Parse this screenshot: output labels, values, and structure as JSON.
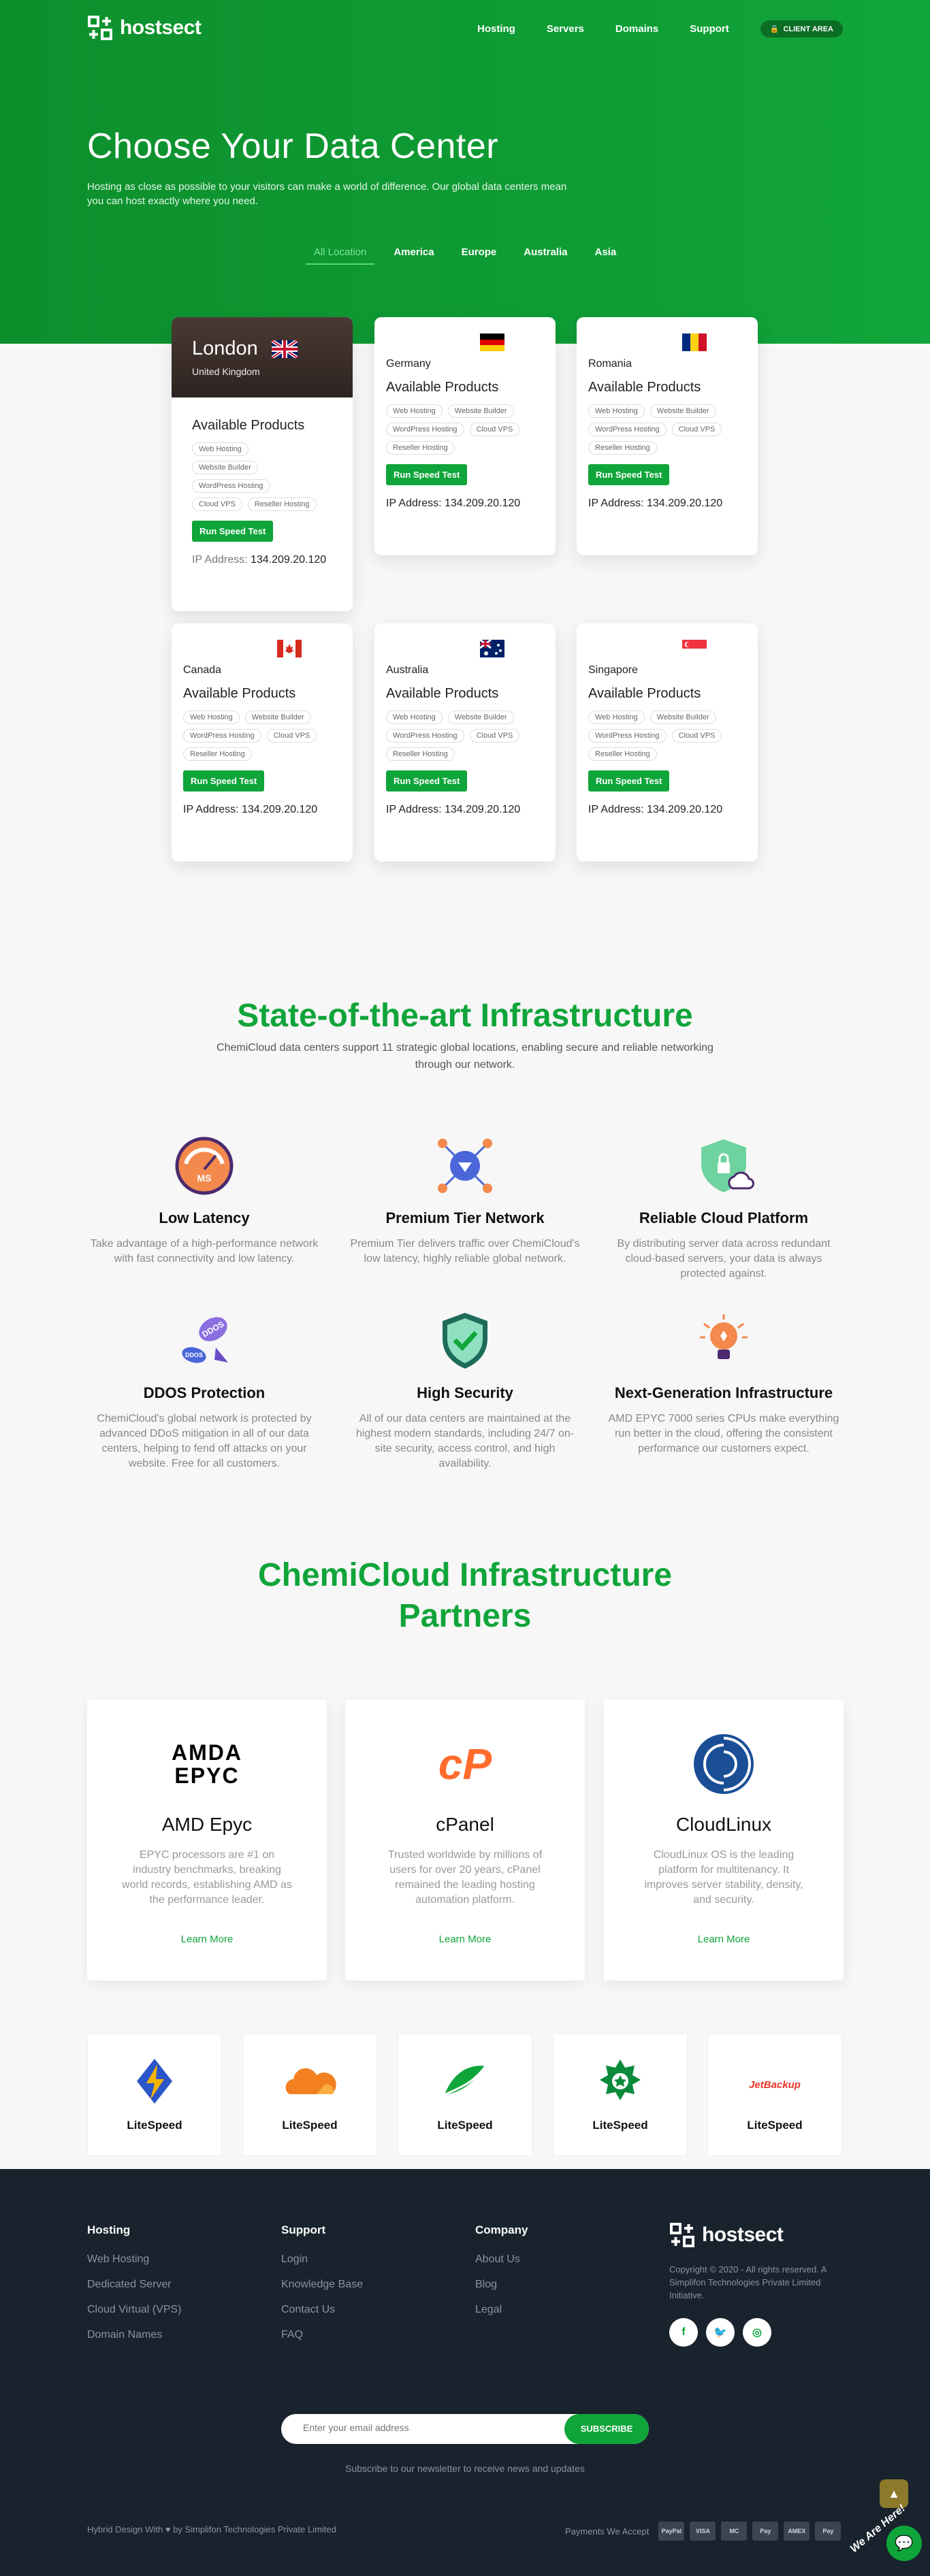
{
  "header": {
    "brand": "hostsect",
    "nav": [
      "Hosting",
      "Servers",
      "Domains",
      "Support"
    ],
    "client_area": "CLIENT AREA"
  },
  "hero": {
    "title": "Choose Your Data Center",
    "subtitle": "Hosting as close as possible to your visitors can make a world of difference. Our global data centers mean you can host exactly where you need.",
    "tabs": [
      "All Location",
      "America",
      "Europe",
      "Australia",
      "Asia"
    ],
    "active_tab": "All Location"
  },
  "datacenters": {
    "products_heading": "Available Products",
    "products": [
      "Web Hosting",
      "Website Builder",
      "WordPress Hosting",
      "Cloud VPS",
      "Reseller Hosting"
    ],
    "button": "Run Speed Test",
    "ip_label": "IP Address:",
    "ip": "134.209.20.120",
    "london": {
      "city": "London",
      "country": "United Kingdom"
    },
    "locations": [
      "Germany",
      "Romania",
      "Canada",
      "Australia",
      "Singapore"
    ]
  },
  "infrastructure": {
    "title": "State-of-the-art Infrastructure",
    "subtitle": "ChemiCloud data centers support 11 strategic global locations, enabling secure and reliable networking through our network.",
    "features": [
      {
        "title": "Low Latency",
        "text": "Take advantage of a high-performance network with fast connectivity and low latency."
      },
      {
        "title": "Premium Tier Network",
        "text": "Premium Tier delivers traffic over ChemiCloud's low latency, highly reliable global network."
      },
      {
        "title": "Reliable Cloud Platform",
        "text": "By distributing server data across redundant cloud-based servers, your data is always protected against."
      },
      {
        "title": "DDOS Protection",
        "text": "ChemiCloud's global network is protected by advanced DDoS mitigation in all of our data centers, helping to fend off attacks on your website. Free for all customers."
      },
      {
        "title": "High Security",
        "text": "All of our data centers are maintained at the highest modern standards, including 24/7 on-site security, access control, and high availability."
      },
      {
        "title": "Next-Generation Infrastructure",
        "text": "AMD EPYC 7000 series CPUs make everything run better in the cloud, offering the consistent performance our customers expect."
      }
    ]
  },
  "partners": {
    "title_line1": "ChemiCloud Infrastructure",
    "title_line2": "Partners",
    "cards": [
      {
        "name": "AMD Epyc",
        "text": "EPYC processors are #1 on industry benchmarks, breaking world records, establishing AMD as the performance leader.",
        "link": "Learn More",
        "logo_text": "AMDA EPYC"
      },
      {
        "name": "cPanel",
        "text": "Trusted worldwide by millions of users for over 20 years, cPanel remained the leading hosting automation platform.",
        "link": "Learn More",
        "logo_text": "cP"
      },
      {
        "name": "CloudLinux",
        "text": "CloudLinux OS is the leading platform for multitenancy. It improves server stability, density, and security.",
        "link": "Learn More"
      }
    ],
    "small_cards": [
      "LiteSpeed",
      "LiteSpeed",
      "LiteSpeed",
      "LiteSpeed",
      "LiteSpeed"
    ],
    "jetbackup": "JetBackup"
  },
  "footer": {
    "columns": [
      {
        "title": "Hosting",
        "links": [
          "Web Hosting",
          "Dedicated Server",
          "Cloud Virtual (VPS)",
          "Domain Names"
        ]
      },
      {
        "title": "Support",
        "links": [
          "Login",
          "Knowledge Base",
          "Contact Us",
          "FAQ"
        ]
      },
      {
        "title": "Company",
        "links": [
          "About Us",
          "Blog",
          "Legal"
        ]
      }
    ],
    "brand": "hostsect",
    "copyright": "Copyright © 2020 - All rights reserved. A Simplifon Technologies Private Limited Initiative.",
    "newsletter_placeholder": "Enter your email address",
    "subscribe": "SUBSCRIBE",
    "newsletter_note": "Subscribe to our newsletter to receive news and updates",
    "credit": "Hybrid Design With ♥ by Simplifon Technologies Private Limited",
    "payments_label": "Payments We Accept",
    "payments": [
      "PayPal",
      "VISA",
      "MC",
      "Pay",
      "AMEX",
      "Pay"
    ],
    "chat_badge": "We Are Here!"
  },
  "colors": {
    "brand_green": "#10a53a",
    "footer_bg": "#19232d"
  }
}
